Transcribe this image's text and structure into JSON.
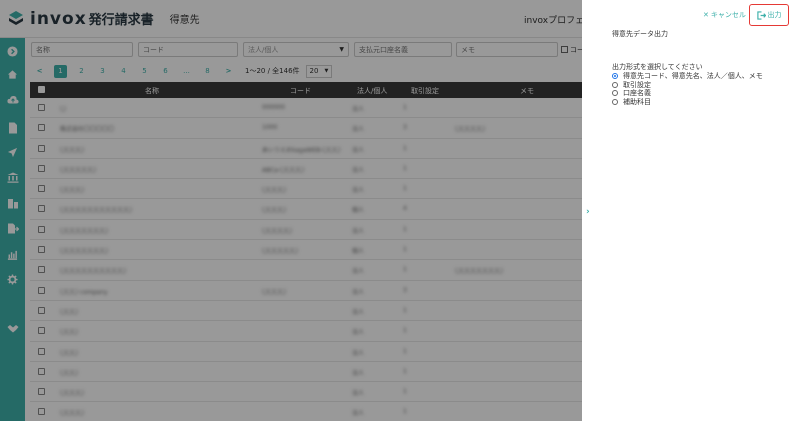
{
  "header": {
    "logo_text": "invox",
    "logo_sub": "発行請求書",
    "page_title": "得意先",
    "org_name": "invoxプロフェッシ"
  },
  "sidebar": {
    "icons": [
      "arrow-right-circle-icon",
      "home-icon",
      "cloud-upload-icon",
      "document-icon",
      "send-icon",
      "bank-icon",
      "building-icon",
      "export-icon",
      "chart-icon",
      "gear-icon",
      "handshake-icon"
    ]
  },
  "filters": {
    "name_placeholder": "名称",
    "code_placeholder": "コード",
    "type_placeholder": "法人/個人",
    "bank_placeholder": "支払元口座名義",
    "memo_placeholder": "メモ",
    "memo_only_label": "コー"
  },
  "pager": {
    "prev": "<",
    "pages": [
      "1",
      "2",
      "3",
      "4",
      "5",
      "6",
      "...",
      "8"
    ],
    "next": ">",
    "count": "1〜20 / 全146件",
    "per_page": "20"
  },
  "table": {
    "headers": [
      "名称",
      "コード",
      "法人/個人",
      "取引設定",
      "メモ"
    ],
    "rows": [
      [
        "〇",
        "000000",
        "法人",
        "1",
        ""
      ],
      [
        "株式会社〇〇〇〇〇",
        "1000",
        "法人",
        "3",
        "〇〇〇〇〇"
      ],
      [
        "〇〇〇〇",
        "あいうえおkagaWEB-〇〇〇",
        "法人",
        "1",
        ""
      ],
      [
        "〇〇〇〇〇〇",
        "ABCa-〇〇〇〇",
        "法人",
        "1",
        ""
      ],
      [
        "〇〇〇〇",
        "〇〇〇〇",
        "法人",
        "1",
        ""
      ],
      [
        "〇〇〇〇〇〇〇〇〇〇〇〇",
        "〇〇〇〇",
        "個人",
        "4",
        ""
      ],
      [
        "〇〇〇〇〇〇〇〇",
        "〇〇〇〇〇",
        "法人",
        "1",
        ""
      ],
      [
        "〇〇〇〇〇〇〇〇",
        "〇〇〇〇〇〇",
        "個人",
        "1",
        ""
      ],
      [
        "〇〇〇〇〇〇〇〇〇〇〇",
        "",
        "法人",
        "1",
        "〇〇〇〇〇〇〇〇"
      ],
      [
        "〇〇〇 company",
        "〇〇〇〇",
        "法人",
        "3",
        ""
      ],
      [
        "〇〇〇",
        "",
        "法人",
        "1",
        ""
      ],
      [
        "〇〇〇",
        "",
        "法人",
        "1",
        ""
      ],
      [
        "〇〇〇",
        "",
        "法人",
        "1",
        ""
      ],
      [
        "〇〇〇",
        "",
        "法人",
        "1",
        ""
      ],
      [
        "〇〇〇〇",
        "",
        "法人",
        "1",
        ""
      ],
      [
        "〇〇〇〇",
        "",
        "法人",
        "1",
        ""
      ]
    ]
  },
  "panel": {
    "cancel_label": "キャンセル",
    "output_label": "出力",
    "title": "得意先データ出力",
    "format_label": "出力形式を選択してください",
    "options": [
      {
        "label": "得意先コード、得意先名、法人／個人、メモ",
        "checked": true
      },
      {
        "label": "取引設定",
        "checked": false
      },
      {
        "label": "口座名義",
        "checked": false
      },
      {
        "label": "補助科目",
        "checked": false
      }
    ]
  },
  "colors": {
    "accent": "#3fb1ab",
    "header_dark": "#3a3a3a",
    "highlight_border": "#e53935",
    "radio_selected": "#1e73e8"
  }
}
